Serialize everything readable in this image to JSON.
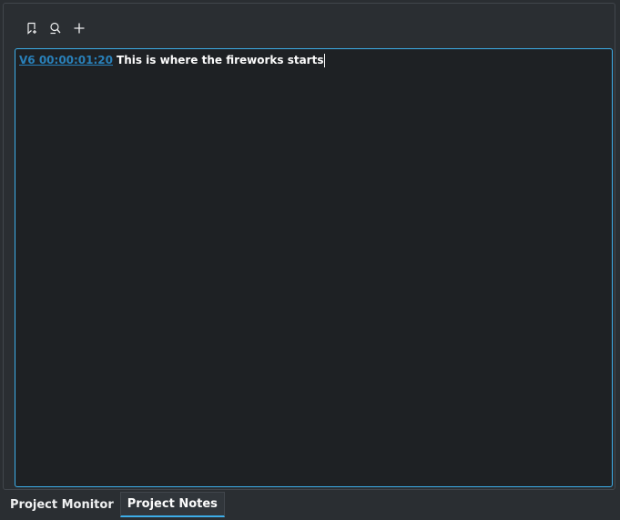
{
  "toolbar": {
    "buttons": [
      {
        "icon": "bookmark-add-icon"
      },
      {
        "icon": "find-icon"
      },
      {
        "icon": "plus-icon"
      }
    ]
  },
  "editor": {
    "note": {
      "timestamp": "V6 00:00:01:20",
      "text": "This is where the fireworks starts"
    }
  },
  "tabs": [
    {
      "label": "Project Monitor",
      "active": false
    },
    {
      "label": "Project Notes",
      "active": true
    }
  ],
  "colors": {
    "accent": "#3daee9",
    "link": "#2980b9",
    "background": "#2a2e32",
    "editor_background": "#1e2124"
  }
}
